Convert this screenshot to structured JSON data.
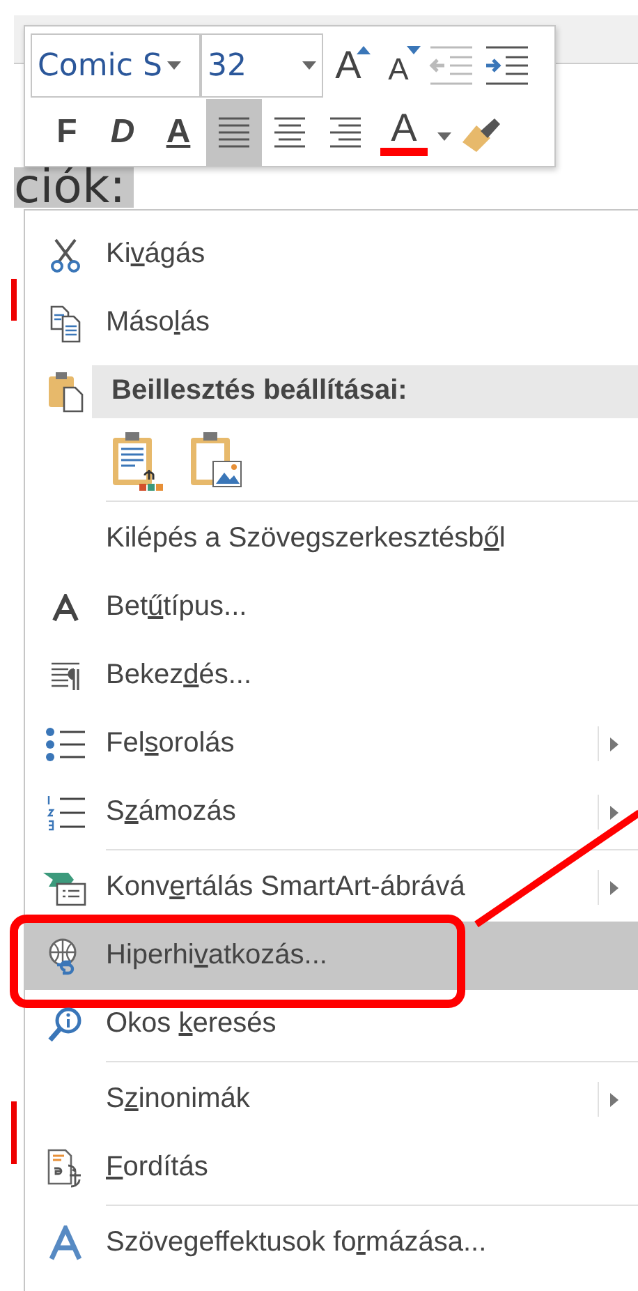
{
  "slide": {
    "text": "ciók:"
  },
  "mini_toolbar": {
    "font_field": {
      "value": "Comic S"
    },
    "size_field": {
      "value": "32"
    },
    "size_buttons": [
      {
        "kind": "grow",
        "label": "A"
      },
      {
        "kind": "shrink",
        "label": "A"
      }
    ],
    "indent_buttons": [
      {
        "kind": "decrease",
        "disabled": true
      },
      {
        "kind": "increase",
        "disabled": false
      }
    ],
    "format_buttons": [
      {
        "kind": "bold",
        "label": "F"
      },
      {
        "kind": "italic",
        "label": "D"
      },
      {
        "kind": "underline",
        "label": "A"
      }
    ],
    "align_buttons": [
      {
        "kind": "left",
        "selected": true
      },
      {
        "kind": "center",
        "selected": false
      },
      {
        "kind": "right",
        "selected": false
      }
    ],
    "font_color": {
      "label": "A",
      "color": "#ff0000"
    }
  },
  "context_menu": {
    "items": [
      {
        "kind": "item",
        "label": {
          "before": "Ki",
          "key": "v",
          "after": "ágás"
        },
        "submenu": false,
        "selected": false,
        "circled": false
      },
      {
        "kind": "item",
        "label": {
          "before": "Máso",
          "key": "l",
          "after": "ás"
        },
        "submenu": false,
        "selected": false,
        "circled": false
      },
      {
        "kind": "header",
        "label": {
          "before": "Beillesztés beállításai:"
        }
      },
      {
        "kind": "paste-options"
      },
      {
        "kind": "separator"
      },
      {
        "kind": "item",
        "label": {
          "before": "Kilépés a Szövegszerkesztésb",
          "key": "ő",
          "after": "l"
        },
        "submenu": false,
        "selected": false,
        "circled": false
      },
      {
        "kind": "item",
        "label": {
          "before": "Bet",
          "key": "ű",
          "after": "típus..."
        },
        "submenu": false,
        "selected": false,
        "circled": false
      },
      {
        "kind": "item",
        "label": {
          "before": "Bekez",
          "key": "d",
          "after": "és..."
        },
        "submenu": false,
        "selected": false,
        "circled": false
      },
      {
        "kind": "item",
        "label": {
          "before": "Fel",
          "key": "s",
          "after": "orolás"
        },
        "submenu": true,
        "selected": false,
        "circled": false
      },
      {
        "kind": "item",
        "label": {
          "before": "S",
          "key": "z",
          "after": "ámozás"
        },
        "submenu": true,
        "selected": false,
        "circled": false
      },
      {
        "kind": "separator"
      },
      {
        "kind": "item",
        "label": {
          "before": "Konv",
          "key": "e",
          "after": "rtálás SmartArt-ábrává"
        },
        "submenu": true,
        "selected": false,
        "circled": false
      },
      {
        "kind": "item",
        "label": {
          "before": "Hiperhi",
          "key": "v",
          "after": "atkozás..."
        },
        "submenu": false,
        "selected": true,
        "circled": true
      },
      {
        "kind": "item",
        "label": {
          "before": "Okos ",
          "key": "k",
          "after": "eresés"
        },
        "submenu": false,
        "selected": false,
        "circled": false
      },
      {
        "kind": "separator"
      },
      {
        "kind": "item",
        "label": {
          "before": "S",
          "key": "z",
          "after": "inonimák"
        },
        "submenu": true,
        "selected": false,
        "circled": false
      },
      {
        "kind": "item",
        "label": {
          "key": "F",
          "after": "ordítás"
        },
        "submenu": false,
        "selected": false,
        "circled": false
      },
      {
        "kind": "separator"
      },
      {
        "kind": "item",
        "label": {
          "before": "Szövegeffektusok fo",
          "key": "r",
          "after": "mázása..."
        },
        "submenu": false,
        "selected": false,
        "circled": false
      }
    ]
  }
}
